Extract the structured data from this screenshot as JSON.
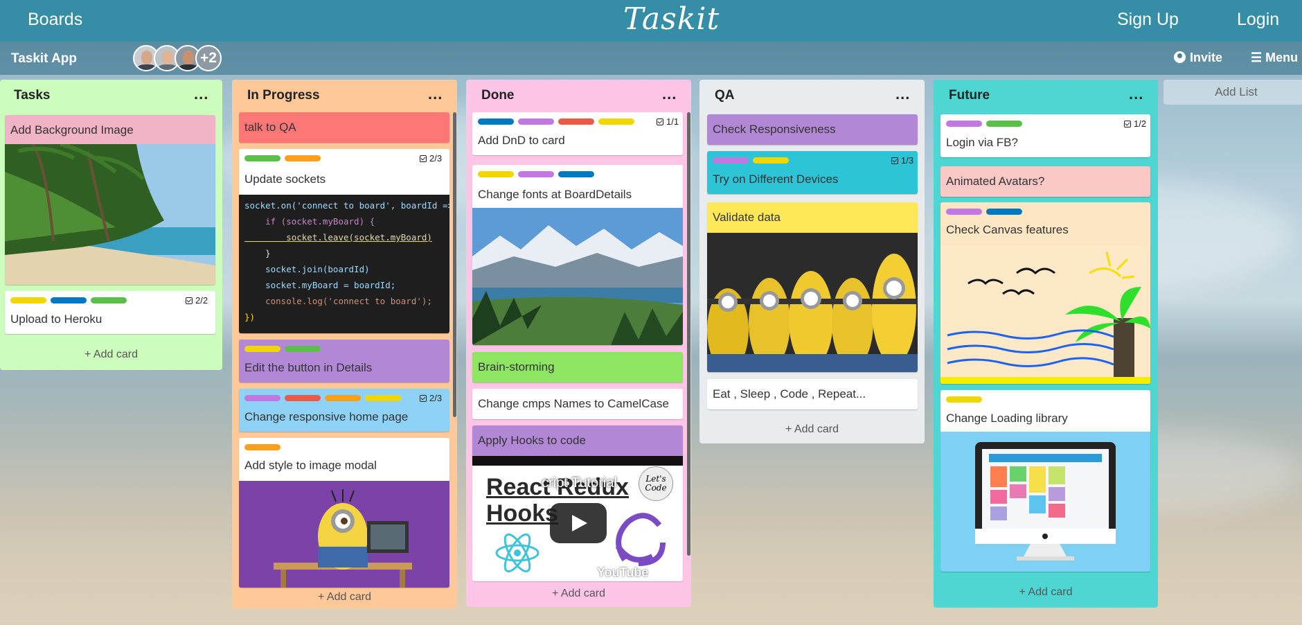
{
  "topbar": {
    "boards": "Boards",
    "logo": "Taskit",
    "sign_up": "Sign Up",
    "login": "Login"
  },
  "subbar": {
    "app_name": "Taskit App",
    "more_members": "+2",
    "invite": "Invite",
    "menu": "☰ Menu"
  },
  "colors": {
    "topbar": "#358ea5",
    "green": "#5bc04a",
    "orange": "#ff9f1a",
    "red": "#eb5a46",
    "yellow": "#f2d600",
    "purple": "#c377e0",
    "blue": "#0079bf"
  },
  "lists": [
    {
      "title": "Tasks",
      "color": "#ccfdbd",
      "add": "+ Add card",
      "cards": [
        {
          "title": "Add Background Image",
          "bg": "#f1b3c6"
        },
        {
          "title": "Upload to Heroku",
          "labels": [
            "yellow",
            "blue",
            "green"
          ],
          "checklist": "2/2"
        }
      ]
    },
    {
      "title": "In Progress",
      "color": "#ffc898",
      "add": "+ Add card",
      "cards": [
        {
          "title": "talk to QA",
          "bg": "#ff7676"
        },
        {
          "title": "Update sockets",
          "labels": [
            "green",
            "orange"
          ],
          "checklist": "2/3"
        },
        {
          "title": "Edit the button in Details",
          "labels": [
            "yellow",
            "green"
          ],
          "bg": "#b288d6"
        },
        {
          "title": "Change responsive home page",
          "labels": [
            "purple",
            "red",
            "orange",
            "yellow"
          ],
          "checklist": "2/3",
          "bg": "#8fd2f7"
        },
        {
          "title": "Add style to image modal",
          "labels": [
            "orange"
          ]
        }
      ],
      "code": [
        "socket.on('connect to board', boardId => {",
        "    if (socket.myBoard) {",
        "        socket.leave(socket.myBoard)",
        "    }",
        "    socket.join(boardId)",
        "    socket.myBoard = boardId;",
        "    console.log('connect to board');",
        "})"
      ]
    },
    {
      "title": "Done",
      "color": "#ffc5e6",
      "add": "+ Add card",
      "cards": [
        {
          "title": "Add DnD to card",
          "labels": [
            "blue",
            "purple",
            "red",
            "yellow"
          ],
          "checklist": "1/1"
        },
        {
          "title": "Change fonts at BoardDetails",
          "labels": [
            "yellow",
            "purple",
            "blue"
          ]
        },
        {
          "title": "Brain-storming",
          "bg": "#8de561"
        },
        {
          "title": "Change cmps Names to CamelCase"
        },
        {
          "title": "Apply Hooks to code",
          "bg": "#b288d6"
        }
      ],
      "video": {
        "line1": "React Redux",
        "line2": "Hooks",
        "overlay": "cript Tutorial",
        "badge_line1": "Let's",
        "badge_line2": "Code",
        "brand": "YouTube"
      }
    },
    {
      "title": "QA",
      "color": "#e8ecef",
      "add": "+ Add card",
      "cards": [
        {
          "title": "Check Responsiveness",
          "bg": "#b288d6"
        },
        {
          "title": "Try on Different Devices",
          "labels": [
            "purple",
            "yellow"
          ],
          "checklist": "1/3",
          "bg": "#2cc4d6"
        },
        {
          "title": "Validate data",
          "bg": "#ffe858"
        },
        {
          "title": "Eat , Sleep , Code , Repeat..."
        }
      ]
    },
    {
      "title": "Future",
      "color": "#4dd6d2",
      "add": "+ Add card",
      "cards": [
        {
          "title": "Login via FB?",
          "labels": [
            "purple",
            "green"
          ],
          "checklist": "1/2"
        },
        {
          "title": "Animated Avatars?",
          "bg": "#fbc8c8"
        },
        {
          "title": "Check Canvas features",
          "labels": [
            "purple",
            "blue"
          ],
          "bg": "#fce6c4"
        },
        {
          "title": "Change Loading library",
          "labels": [
            "yellow"
          ]
        }
      ]
    }
  ],
  "add_list": "Add List",
  "list_menu": "..."
}
